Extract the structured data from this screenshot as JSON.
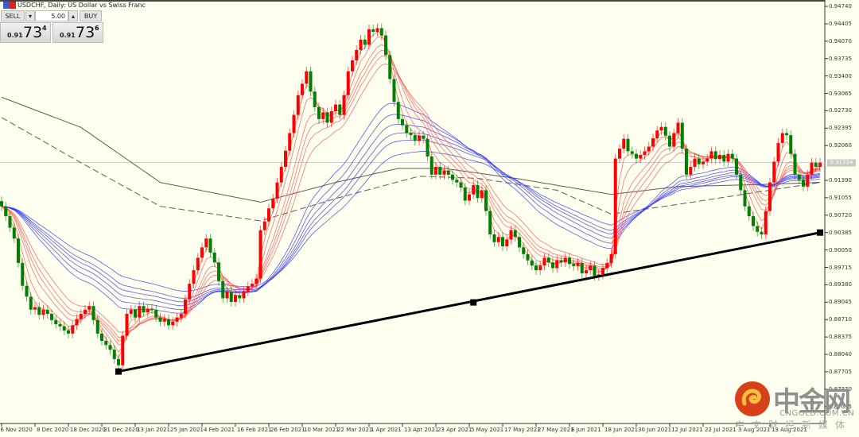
{
  "header": {
    "title": "USDCHF, Daily:  US Dollar vs Swiss Franc"
  },
  "trade_panel": {
    "sell_label": "SELL",
    "buy_label": "BUY",
    "volume": "5.00",
    "down_arrow": "▾",
    "up_arrow": "▴",
    "bid": {
      "prefix": "0.91",
      "big": "73",
      "sup": "4"
    },
    "ask": {
      "prefix": "0.91",
      "big": "73",
      "sup": "6"
    }
  },
  "watermark": {
    "name": "中金网",
    "domain": "CNGOLD.COM.CN",
    "tagline": "中文财经新媒体"
  },
  "colors": {
    "background": "#fffff0",
    "bull_candle": "#ff0000",
    "bear_candle": "#008000",
    "fast_ribbon": "#ff5050",
    "slow_ribbon": "#3030ff",
    "long_ma": "#333333",
    "trendline": "#000000"
  },
  "chart_data": {
    "type": "candlestick",
    "symbol": "USDCHF",
    "timeframe": "Daily",
    "ylim": [
      0.869,
      0.948
    ],
    "y_ticks": [
      "0.94740",
      "0.94405",
      "0.94070",
      "0.93735",
      "0.93400",
      "0.93065",
      "0.92730",
      "0.92395",
      "0.92060",
      "0.91390",
      "0.91055",
      "0.90720",
      "0.90385",
      "0.90050",
      "0.89715",
      "0.89380",
      "0.89045",
      "0.88710",
      "0.88375",
      "0.88040",
      "0.87705",
      "0.87370",
      "0.87035"
    ],
    "current_price": "0.91734",
    "x_ticks": [
      "26 Nov 2020",
      "8 Dec 2020",
      "18 Dec 2020",
      "31 Dec 2020",
      "13 Jan 2021",
      "25 Jan 2021",
      "4 Feb 2021",
      "16 Feb 2021",
      "26 Feb 2021",
      "10 Mar 2021",
      "22 Mar 2021",
      "1 Apr 2021",
      "13 Apr 2021",
      "23 Apr 2021",
      "5 May 2021",
      "17 May 2021",
      "27 May 2021",
      "8 Jun 2021",
      "18 Jun 2021",
      "30 Jun 2021",
      "12 Jul 2021",
      "22 Jul 2021",
      "3 Aug 2021",
      "13 Aug 2021"
    ],
    "closes": [
      0.9089,
      0.907,
      0.9048,
      0.9027,
      0.898,
      0.8936,
      0.8915,
      0.889,
      0.8895,
      0.888,
      0.889,
      0.8882,
      0.887,
      0.8862,
      0.8858,
      0.885,
      0.8844,
      0.886,
      0.8872,
      0.8882,
      0.889,
      0.8897,
      0.887,
      0.8844,
      0.883,
      0.8822,
      0.8813,
      0.8795,
      0.8783,
      0.884,
      0.8882,
      0.889,
      0.8875,
      0.8897,
      0.8885,
      0.8892,
      0.889,
      0.8875,
      0.8867,
      0.8872,
      0.886,
      0.8867,
      0.8875,
      0.8882,
      0.891,
      0.894,
      0.8966,
      0.899,
      0.901,
      0.9027,
      0.9,
      0.8981,
      0.8945,
      0.8912,
      0.8925,
      0.8905,
      0.8918,
      0.8912,
      0.8925,
      0.8935,
      0.894,
      0.895,
      0.9043,
      0.906,
      0.9085,
      0.9104,
      0.9135,
      0.9165,
      0.9196,
      0.923,
      0.9265,
      0.9303,
      0.9325,
      0.9349,
      0.931,
      0.928,
      0.9257,
      0.927,
      0.925,
      0.9272,
      0.9285,
      0.9265,
      0.9303,
      0.9349,
      0.937,
      0.939,
      0.941,
      0.94,
      0.943,
      0.9425,
      0.9432,
      0.9418,
      0.938,
      0.9334,
      0.929,
      0.9257,
      0.9245,
      0.923,
      0.9226,
      0.9215,
      0.9225,
      0.9219,
      0.9185,
      0.915,
      0.9165,
      0.915,
      0.9158,
      0.915,
      0.914,
      0.9135,
      0.9125,
      0.91,
      0.9112,
      0.913,
      0.9105,
      0.912,
      0.908,
      0.9035,
      0.902,
      0.903,
      0.9012,
      0.9025,
      0.9043,
      0.903,
      0.901,
      0.8997,
      0.8985,
      0.8975,
      0.8966,
      0.8975,
      0.899,
      0.8981,
      0.897,
      0.8985,
      0.8981,
      0.899,
      0.8978,
      0.8974,
      0.898,
      0.896,
      0.8966,
      0.8975,
      0.8955,
      0.8958,
      0.897,
      0.898,
      0.8997,
      0.9181,
      0.92,
      0.9219,
      0.9195,
      0.919,
      0.9181,
      0.9188,
      0.9195,
      0.9204,
      0.922,
      0.9235,
      0.9242,
      0.9225,
      0.9204,
      0.923,
      0.925,
      0.92,
      0.915,
      0.9165,
      0.9181,
      0.917,
      0.9175,
      0.9181,
      0.9195,
      0.918,
      0.9188,
      0.9175,
      0.919,
      0.9181,
      0.915,
      0.912,
      0.9089,
      0.907,
      0.9051,
      0.904,
      0.9035,
      0.908,
      0.9135,
      0.9175,
      0.9211,
      0.923,
      0.9226,
      0.919,
      0.915,
      0.914,
      0.9127,
      0.915,
      0.9173,
      0.9165,
      0.9173
    ],
    "long_ma_solid": [
      [
        0,
        0.9299
      ],
      [
        19,
        0.9241
      ],
      [
        38,
        0.9135
      ],
      [
        62,
        0.9097
      ],
      [
        80,
        0.9135
      ],
      [
        95,
        0.9162
      ],
      [
        106,
        0.9162
      ],
      [
        123,
        0.9143
      ],
      [
        146,
        0.9112
      ],
      [
        162,
        0.9127
      ],
      [
        182,
        0.9131
      ],
      [
        196,
        0.9135
      ]
    ],
    "long_ma_dashed": [
      [
        0,
        0.926
      ],
      [
        19,
        0.9173
      ],
      [
        38,
        0.9089
      ],
      [
        62,
        0.9061
      ],
      [
        80,
        0.9104
      ],
      [
        100,
        0.9147
      ],
      [
        114,
        0.9143
      ],
      [
        133,
        0.912
      ],
      [
        146,
        0.9074
      ],
      [
        163,
        0.9094
      ],
      [
        196,
        0.9135
      ]
    ],
    "trendline": {
      "start": [
        28,
        0.8771
      ],
      "mid": [
        113,
        0.8904
      ],
      "end": [
        196,
        0.90385
      ]
    }
  }
}
